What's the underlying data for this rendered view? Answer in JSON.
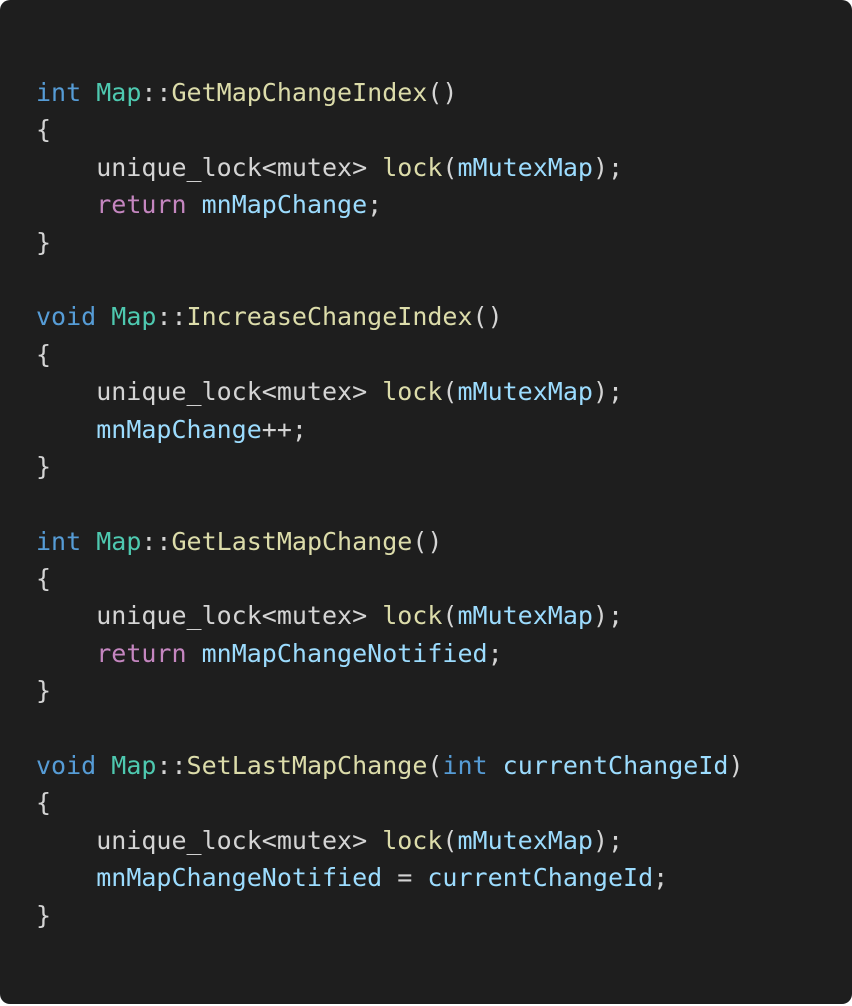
{
  "colors": {
    "background": "#1e1e1e",
    "keyword": "#569cd6",
    "control": "#c586c0",
    "type": "#4ec9b0",
    "function": "#dcdcaa",
    "variable": "#9cdcfe",
    "plain": "#d4d4d4"
  },
  "code_lines": [
    [
      {
        "kind": "keyword",
        "text": "int"
      },
      {
        "kind": "plain",
        "text": " "
      },
      {
        "kind": "type",
        "text": "Map"
      },
      {
        "kind": "plain",
        "text": "::"
      },
      {
        "kind": "func",
        "text": "GetMapChangeIndex"
      },
      {
        "kind": "plain",
        "text": "()"
      }
    ],
    [
      {
        "kind": "plain",
        "text": "{"
      }
    ],
    [
      {
        "kind": "plain",
        "text": "    unique_lock<mutex> "
      },
      {
        "kind": "func",
        "text": "lock"
      },
      {
        "kind": "plain",
        "text": "("
      },
      {
        "kind": "var",
        "text": "mMutexMap"
      },
      {
        "kind": "plain",
        "text": ");"
      }
    ],
    [
      {
        "kind": "plain",
        "text": "    "
      },
      {
        "kind": "control",
        "text": "return"
      },
      {
        "kind": "plain",
        "text": " "
      },
      {
        "kind": "var",
        "text": "mnMapChange"
      },
      {
        "kind": "plain",
        "text": ";"
      }
    ],
    [
      {
        "kind": "plain",
        "text": "}"
      }
    ],
    [],
    [
      {
        "kind": "keyword",
        "text": "void"
      },
      {
        "kind": "plain",
        "text": " "
      },
      {
        "kind": "type",
        "text": "Map"
      },
      {
        "kind": "plain",
        "text": "::"
      },
      {
        "kind": "func",
        "text": "IncreaseChangeIndex"
      },
      {
        "kind": "plain",
        "text": "()"
      }
    ],
    [
      {
        "kind": "plain",
        "text": "{"
      }
    ],
    [
      {
        "kind": "plain",
        "text": "    unique_lock<mutex> "
      },
      {
        "kind": "func",
        "text": "lock"
      },
      {
        "kind": "plain",
        "text": "("
      },
      {
        "kind": "var",
        "text": "mMutexMap"
      },
      {
        "kind": "plain",
        "text": ");"
      }
    ],
    [
      {
        "kind": "plain",
        "text": "    "
      },
      {
        "kind": "var",
        "text": "mnMapChange"
      },
      {
        "kind": "plain",
        "text": "++;"
      }
    ],
    [
      {
        "kind": "plain",
        "text": "}"
      }
    ],
    [],
    [
      {
        "kind": "keyword",
        "text": "int"
      },
      {
        "kind": "plain",
        "text": " "
      },
      {
        "kind": "type",
        "text": "Map"
      },
      {
        "kind": "plain",
        "text": "::"
      },
      {
        "kind": "func",
        "text": "GetLastMapChange"
      },
      {
        "kind": "plain",
        "text": "()"
      }
    ],
    [
      {
        "kind": "plain",
        "text": "{"
      }
    ],
    [
      {
        "kind": "plain",
        "text": "    unique_lock<mutex> "
      },
      {
        "kind": "func",
        "text": "lock"
      },
      {
        "kind": "plain",
        "text": "("
      },
      {
        "kind": "var",
        "text": "mMutexMap"
      },
      {
        "kind": "plain",
        "text": ");"
      }
    ],
    [
      {
        "kind": "plain",
        "text": "    "
      },
      {
        "kind": "control",
        "text": "return"
      },
      {
        "kind": "plain",
        "text": " "
      },
      {
        "kind": "var",
        "text": "mnMapChangeNotified"
      },
      {
        "kind": "plain",
        "text": ";"
      }
    ],
    [
      {
        "kind": "plain",
        "text": "}"
      }
    ],
    [],
    [
      {
        "kind": "keyword",
        "text": "void"
      },
      {
        "kind": "plain",
        "text": " "
      },
      {
        "kind": "type",
        "text": "Map"
      },
      {
        "kind": "plain",
        "text": "::"
      },
      {
        "kind": "func",
        "text": "SetLastMapChange"
      },
      {
        "kind": "plain",
        "text": "("
      },
      {
        "kind": "keyword",
        "text": "int"
      },
      {
        "kind": "plain",
        "text": " "
      },
      {
        "kind": "var",
        "text": "currentChangeId"
      },
      {
        "kind": "plain",
        "text": ")"
      }
    ],
    [
      {
        "kind": "plain",
        "text": "{"
      }
    ],
    [
      {
        "kind": "plain",
        "text": "    unique_lock<mutex> "
      },
      {
        "kind": "func",
        "text": "lock"
      },
      {
        "kind": "plain",
        "text": "("
      },
      {
        "kind": "var",
        "text": "mMutexMap"
      },
      {
        "kind": "plain",
        "text": ");"
      }
    ],
    [
      {
        "kind": "plain",
        "text": "    "
      },
      {
        "kind": "var",
        "text": "mnMapChangeNotified"
      },
      {
        "kind": "plain",
        "text": " = "
      },
      {
        "kind": "var",
        "text": "currentChangeId"
      },
      {
        "kind": "plain",
        "text": ";"
      }
    ],
    [
      {
        "kind": "plain",
        "text": "}"
      }
    ]
  ]
}
